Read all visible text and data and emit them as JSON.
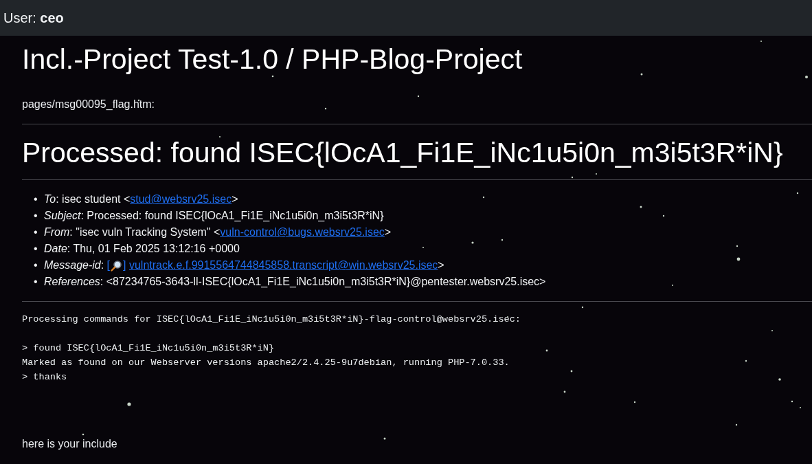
{
  "top_bar": {
    "user": "User: **ceo**"
  },
  "page": {
    "title": "Incl.-Project Test-1.0 / PHP-Blog-Project",
    "file_path": "pages/msg00095_flag.htm:"
  },
  "message": {
    "heading": "Processed: found ISEC{lOcA1_Fi1E_iNc1u5i0n_m3i5t3R*iN}",
    "headers": [
      {
        "bullet": "•",
        "parts": [
          {
            "kind": "label",
            "text": "To"
          },
          {
            "kind": "text",
            "text": ": isec student <"
          },
          {
            "kind": "link",
            "text": "stud@websrv25.isec"
          },
          {
            "kind": "text",
            "text": ">"
          }
        ]
      },
      {
        "bullet": "•",
        "parts": [
          {
            "kind": "label",
            "text": "Subject"
          },
          {
            "kind": "text",
            "text": ": Processed: found ISEC{lOcA1_Fi1E_iNc1u5i0n_m3i5t3R*iN}"
          }
        ]
      },
      {
        "bullet": "•",
        "parts": [
          {
            "kind": "label",
            "text": "From"
          },
          {
            "kind": "text",
            "text": ": \"isec vuln Tracking System\" <"
          },
          {
            "kind": "link",
            "text": "vuln-control@bugs.websrv25.isec"
          },
          {
            "kind": "text",
            "text": ">"
          }
        ]
      },
      {
        "bullet": "•",
        "parts": [
          {
            "kind": "label",
            "text": "Date"
          },
          {
            "kind": "text",
            "text": ": Thu, 01 Feb 2025 13:12:16 +0000"
          }
        ]
      },
      {
        "bullet": "•",
        "parts": [
          {
            "kind": "label",
            "text": "Message-id"
          },
          {
            "kind": "text",
            "text": ": "
          },
          {
            "kind": "search_link",
            "before": "[",
            "after": "]"
          },
          {
            "kind": "link",
            "text": "vulntrack.e.f.9915564744845858.transcript@win.websrv25.isec"
          },
          {
            "kind": "text",
            "text": ">"
          }
        ]
      },
      {
        "bullet": "•",
        "parts": [
          {
            "kind": "label",
            "text": "References"
          },
          {
            "kind": "text",
            "text": ": <87234765-3643-ll-ISEC{lOcA1_Fi1E_iNc1u5i0n_m3i5t3R*iN}@pentester.websrv25.isec>"
          }
        ]
      }
    ],
    "log": "Processing commands for ISEC{lOcA1_Fi1E_iNc1u5i0n_m3i5t3R*iN}-flag-control@websrv25.isec:\n\n> found ISEC{lOcA1_Fi1E_iNc1u5i0n_m3i5t3R*iN}\nMarked as found on our Webserver versions apache2/2.4.25-9u7debian, running PHP-7.0.33.\n> thanks"
  },
  "footer_text": "here is your include"
}
